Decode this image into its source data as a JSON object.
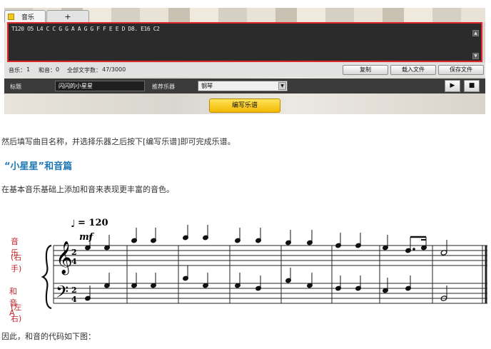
{
  "tabs": [
    {
      "label": "音乐"
    },
    {
      "label": "+"
    }
  ],
  "editor": {
    "code": "T120 O5 L4 C C G G A A G G F F E E D D8. E16 C2"
  },
  "status": {
    "music_label": "音乐：",
    "music_value": "1",
    "harmony_label": "和音：",
    "harmony_value": "0",
    "total_label": "全部文字数：",
    "total_value": "47/3000"
  },
  "buttons": {
    "copy": "复制",
    "load_file": "载入文件",
    "save_file": "保存文件",
    "compose": "编写乐谱"
  },
  "form": {
    "title_label": "标题",
    "title_value": "闪闪的小星星",
    "instrument_label": "推荐乐器",
    "instrument_value": "钢琴"
  },
  "controls": {
    "play_icon": "play-icon",
    "stop_icon": "stop-icon"
  },
  "article": {
    "p1": "然后填写曲目名称，并选择乐器之后按下[编写乐谱]即可完成乐谱。",
    "heading": "“小星星”和音篇",
    "p2": "在基本音乐基础上添加和音来表现更丰富的音色。",
    "p3": "因此，和音的代码如下图："
  },
  "score": {
    "tempo": "= 120",
    "dynamic": "mf",
    "time_signature": "2/4",
    "part_labels": {
      "treble_1": "音乐",
      "treble_2": "(右手)",
      "bass_1": "和音A",
      "bass_2": "(左右)"
    }
  },
  "colors": {
    "accent_blue": "#1f77b4",
    "label_red": "#c0282e",
    "editor_border": "#e0262b",
    "compose_button": "#f7c51a"
  }
}
